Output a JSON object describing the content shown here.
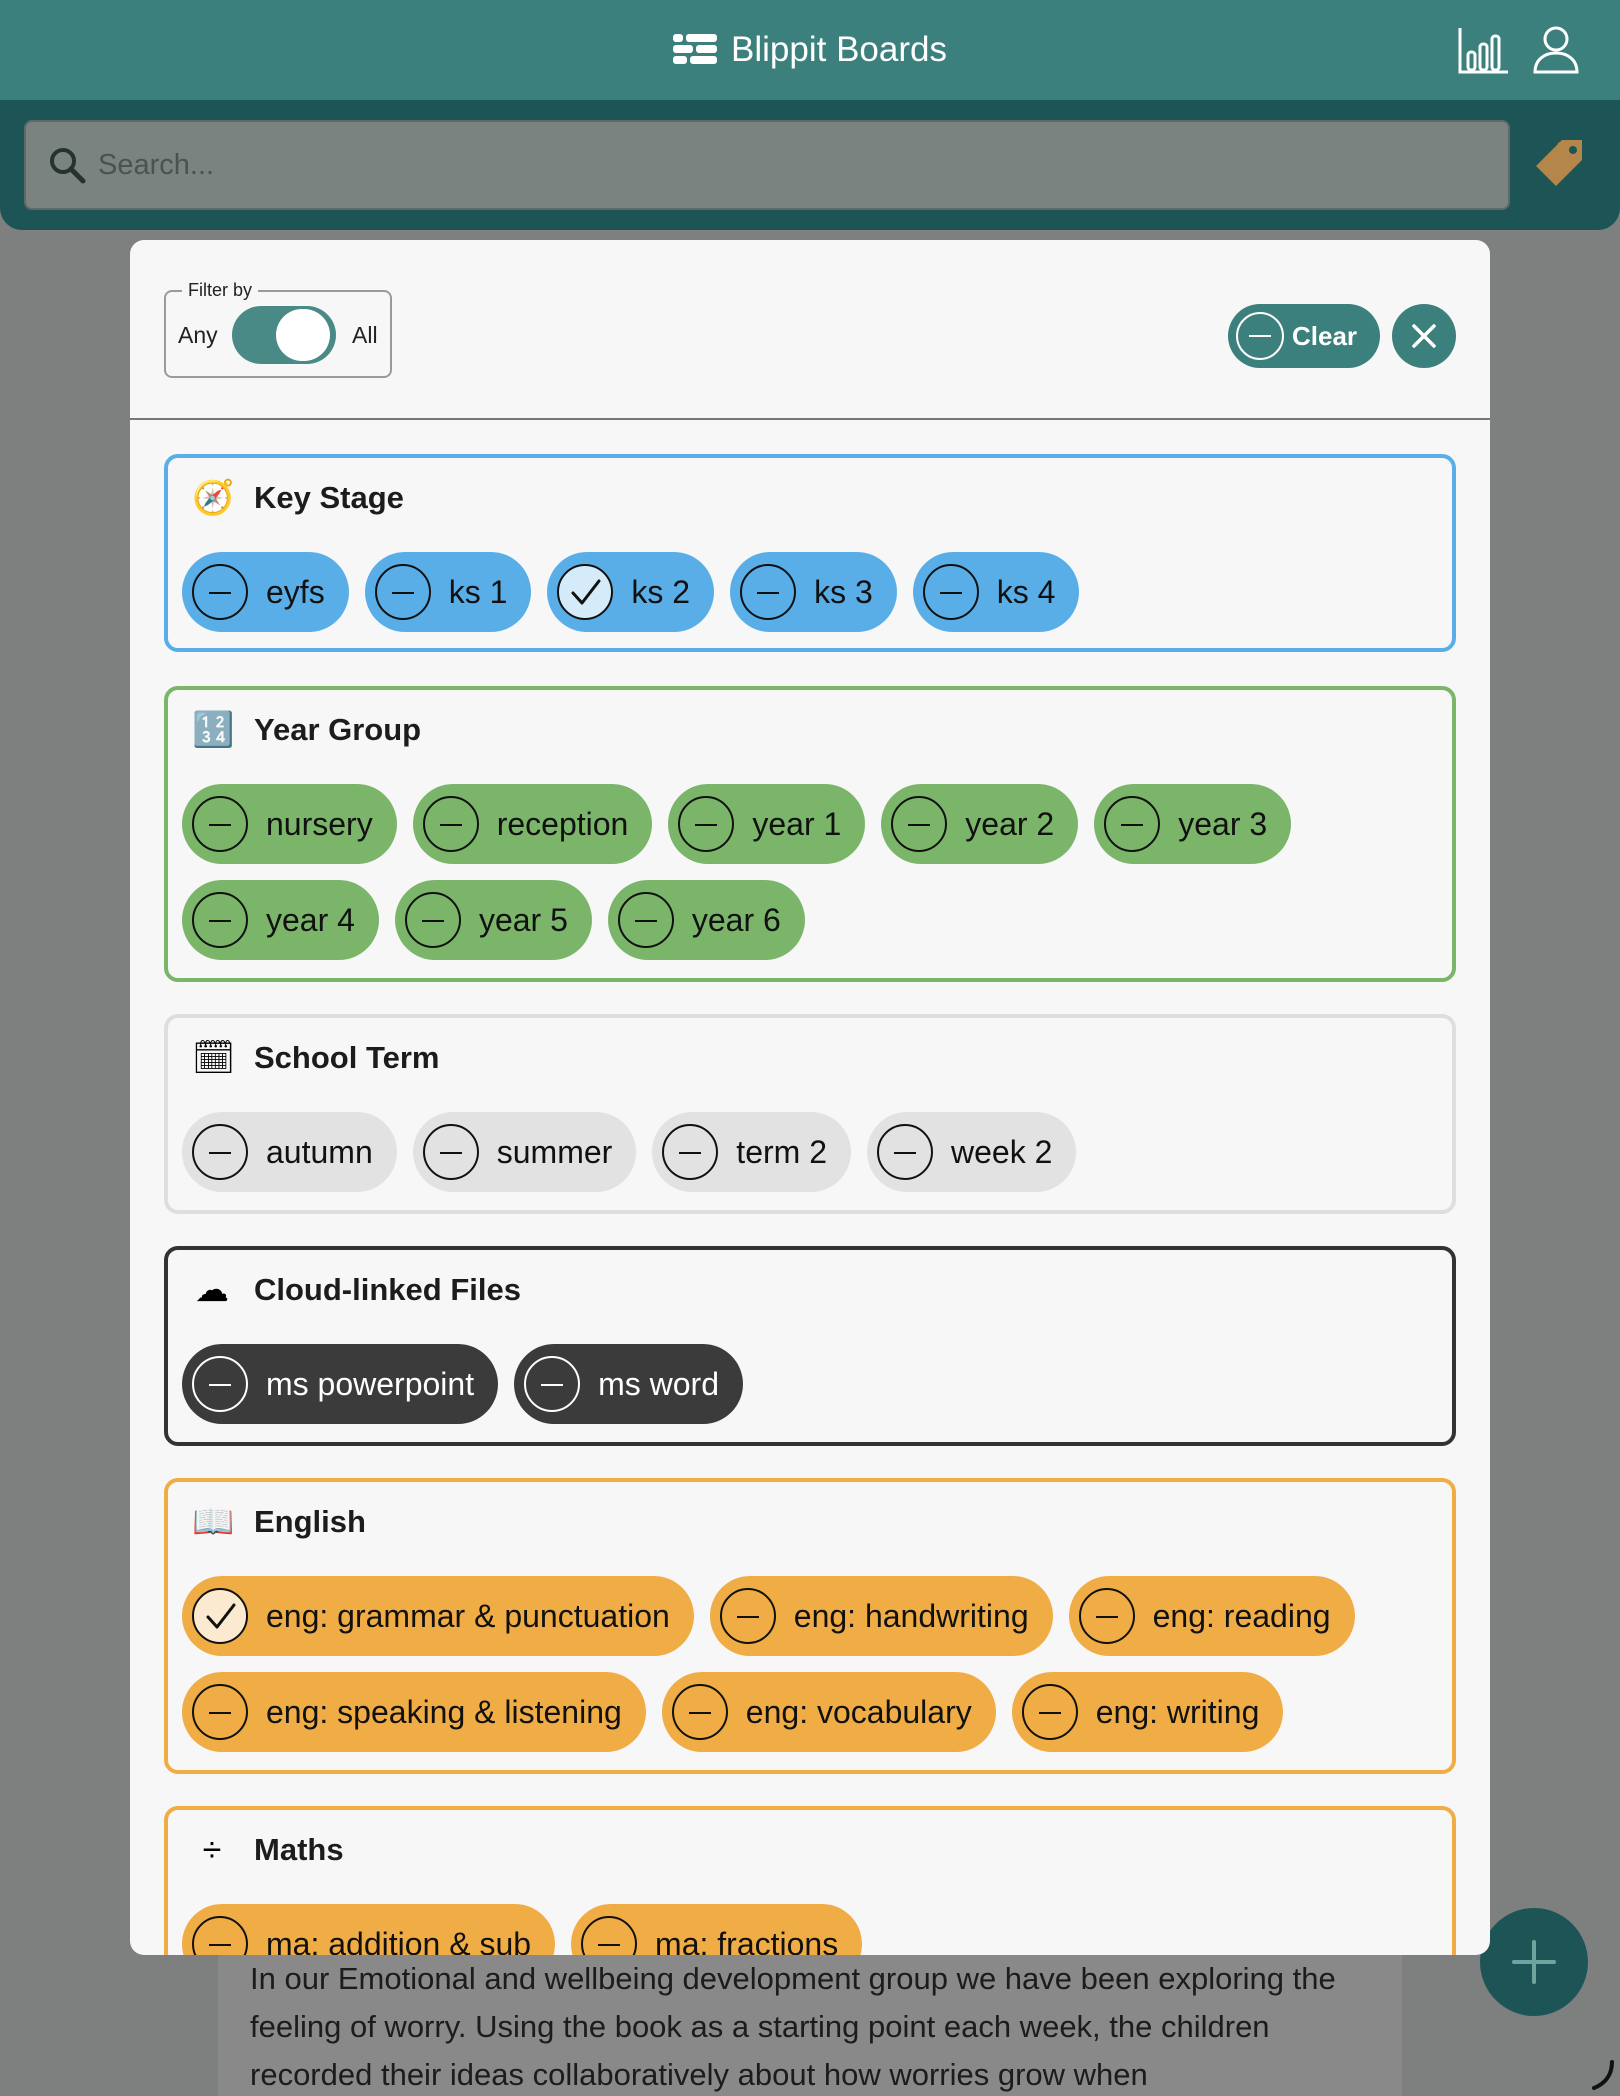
{
  "header": {
    "title": "Blippit Boards",
    "stats_icon": "bar-chart-icon",
    "profile_icon": "user-icon",
    "logo_icon": "boards-logo-icon"
  },
  "search": {
    "placeholder": "Search...",
    "value": "",
    "tag_icon": "tag-icon"
  },
  "filter": {
    "legend": "Filter by",
    "option_left": "Any",
    "option_right": "All",
    "mode_selected": "All"
  },
  "actions": {
    "clear_label": "Clear",
    "close_icon": "close-icon"
  },
  "colors": {
    "primary": "#3b807c",
    "dark_teal": "#1d5556",
    "blue": "#5aaee7",
    "green": "#7ab56a",
    "gray": "#e2e2e2",
    "dark": "#3b3b3b",
    "orange": "#f1ad45"
  },
  "groups": [
    {
      "title": "Key Stage",
      "icon": "compass-icon",
      "glyph": "🧭",
      "tags": [
        {
          "label": "eyfs",
          "selected": false
        },
        {
          "label": "ks 1",
          "selected": false
        },
        {
          "label": "ks 2",
          "selected": true
        },
        {
          "label": "ks 3",
          "selected": false
        },
        {
          "label": "ks 4",
          "selected": false
        }
      ]
    },
    {
      "title": "Year Group",
      "icon": "numbers-icon",
      "glyph": "🔢",
      "tags": [
        {
          "label": "nursery",
          "selected": false
        },
        {
          "label": "reception",
          "selected": false
        },
        {
          "label": "year 1",
          "selected": false
        },
        {
          "label": "year 2",
          "selected": false
        },
        {
          "label": "year 3",
          "selected": false
        },
        {
          "label": "year 4",
          "selected": false
        },
        {
          "label": "year 5",
          "selected": false
        },
        {
          "label": "year 6",
          "selected": false
        }
      ]
    },
    {
      "title": "School Term",
      "icon": "calendar-icon",
      "glyph": "🗓",
      "tags": [
        {
          "label": "autumn",
          "selected": false
        },
        {
          "label": "summer",
          "selected": false
        },
        {
          "label": "term 2",
          "selected": false
        },
        {
          "label": "week 2",
          "selected": false
        }
      ]
    },
    {
      "title": "Cloud-linked Files",
      "icon": "cloud-icon",
      "glyph": "☁",
      "tags": [
        {
          "label": "ms powerpoint",
          "selected": false
        },
        {
          "label": "ms word",
          "selected": false
        }
      ]
    },
    {
      "title": "English",
      "icon": "book-icon",
      "glyph": "📖",
      "tags": [
        {
          "label": "eng: grammar & punctuation",
          "selected": true
        },
        {
          "label": "eng: handwriting",
          "selected": false
        },
        {
          "label": "eng: reading",
          "selected": false
        },
        {
          "label": "eng: speaking & listening",
          "selected": false
        },
        {
          "label": "eng: vocabulary",
          "selected": false
        },
        {
          "label": "eng: writing",
          "selected": false
        }
      ]
    },
    {
      "title": "Maths",
      "icon": "divide-icon",
      "glyph": "÷",
      "tags": [
        {
          "label": "ma: addition & sub",
          "selected": false
        },
        {
          "label": "ma: fractions",
          "selected": false
        }
      ]
    }
  ],
  "background_post": {
    "text": "In our Emotional and wellbeing development group we have been exploring the feeling of worry. Using the book as a starting point each week, the children recorded their ideas collaboratively about how worries grow when"
  },
  "fab": {
    "icon": "plus-icon"
  }
}
